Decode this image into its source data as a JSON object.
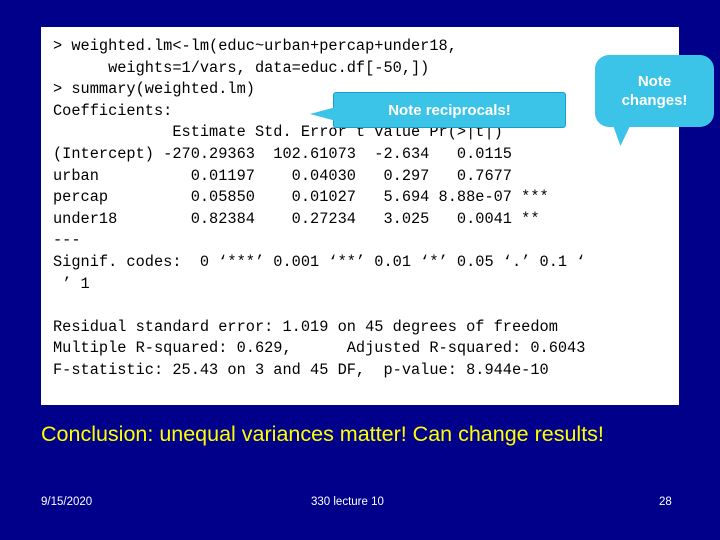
{
  "slide": {
    "background_color": "#00008B",
    "code_panel": {
      "background_color": "#FFFFFF",
      "text": "> weighted.lm<-lm(educ~urban+percap+under18,\n      weights=1/vars, data=educ.df[-50,])\n> summary(weighted.lm)\nCoefficients:\n             Estimate Std. Error t value Pr(>|t|)\n(Intercept) -270.29363  102.61073  -2.634   0.0115\nurban          0.01197    0.04030   0.297   0.7677\npercap         0.05850    0.01027   5.694 8.88e-07 ***\nunder18        0.82384    0.27234   3.025   0.0041 **\n---\nSignif. codes:  0 ‘***’ 0.001 ‘**’ 0.01 ‘*’ 0.05 ‘.’ 0.1 ‘\n ’ 1\n\nResidual standard error: 1.019 on 45 degrees of freedom\nMultiple R-squared: 0.629,      Adjusted R-squared: 0.6043\nF-statistic: 25.43 on 3 and 45 DF,  p-value: 8.944e-10"
    },
    "callouts": {
      "reciprocals": {
        "label": "Note reciprocals!",
        "color": "#3BC3E8",
        "text_color": "#FFFFFF"
      },
      "changes": {
        "line1": "Note",
        "line2": "changes!",
        "color": "#3BC3E8",
        "text_color": "#FFFFFF"
      }
    },
    "conclusion": {
      "text": "Conclusion: unequal variances matter! Can change results!",
      "color": "#FFFF00"
    },
    "footer": {
      "date": "9/15/2020",
      "center": "330 lecture 10",
      "page": "28",
      "color": "#FFFFFF"
    }
  }
}
